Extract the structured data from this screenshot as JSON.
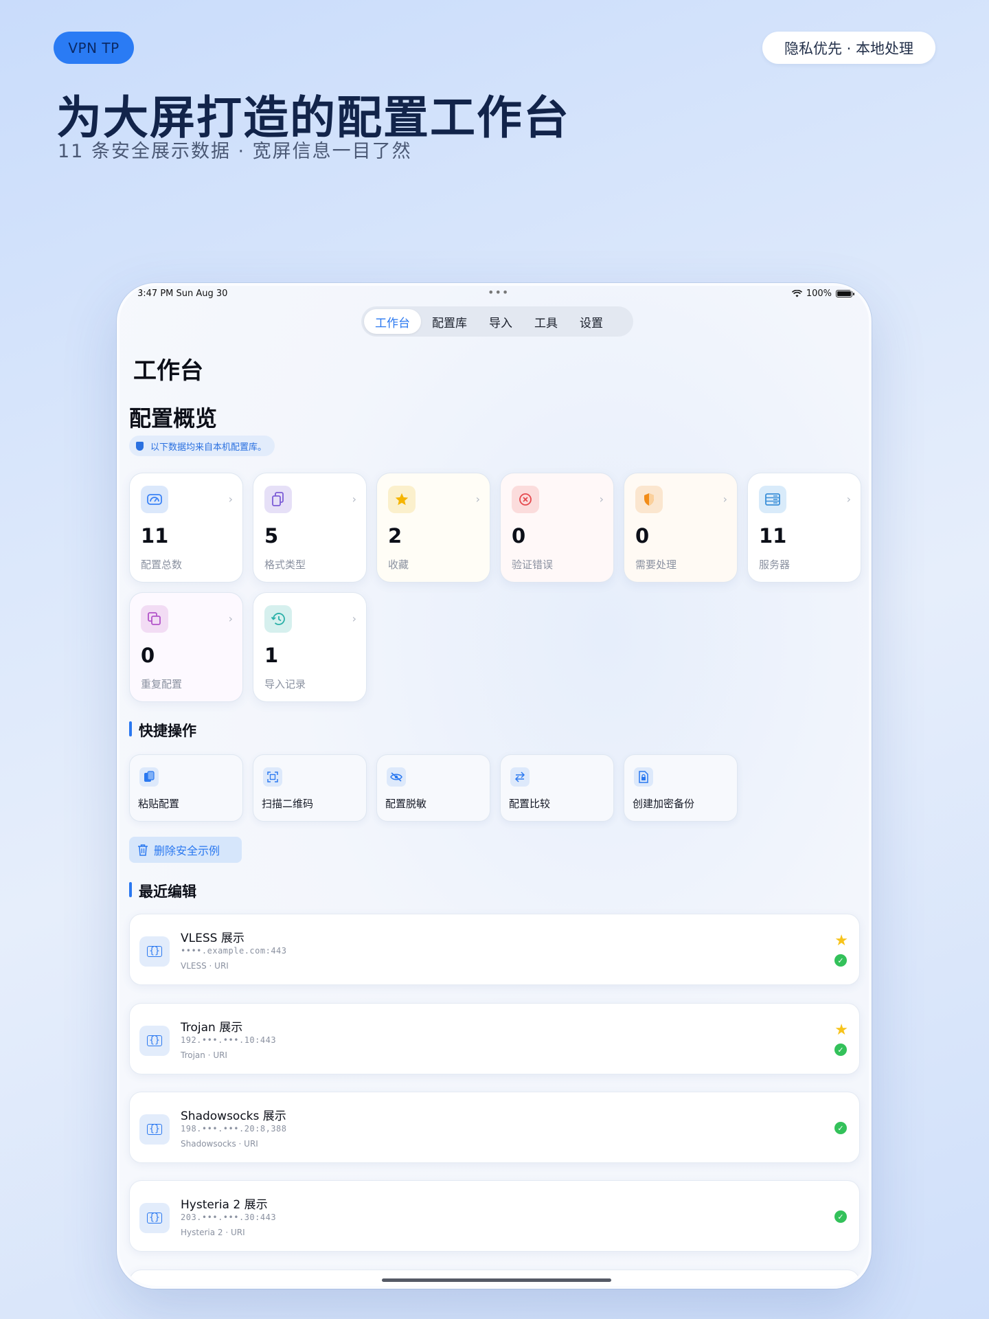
{
  "promo": {
    "brand": "VPN TP",
    "privacy": "隐私优先 · 本地处理",
    "title": "为大屏打造的配置工作台",
    "subtitle": "11 条安全展示数据 · 宽屏信息一目了然"
  },
  "status_bar": {
    "time": "3:47 PM  Sun Aug 30",
    "battery": "100%"
  },
  "tabs": [
    {
      "label": "工作台",
      "active": true
    },
    {
      "label": "配置库",
      "active": false
    },
    {
      "label": "导入",
      "active": false
    },
    {
      "label": "工具",
      "active": false
    },
    {
      "label": "设置",
      "active": false
    }
  ],
  "page_title": "工作台",
  "overview": {
    "title": "配置概览",
    "note": "以下数据均来自本机配置库。",
    "stats": [
      {
        "value": "11",
        "label": "配置总数",
        "icon": "gauge-icon",
        "accent": "#3b82f6",
        "bg": "#dbe8fb"
      },
      {
        "value": "5",
        "label": "格式类型",
        "icon": "documents-icon",
        "accent": "#7c5cd6",
        "bg": "#e6e0f7"
      },
      {
        "value": "2",
        "label": "收藏",
        "icon": "star-icon",
        "accent": "#f5b400",
        "bg": "#fbf0cc"
      },
      {
        "value": "0",
        "label": "验证错误",
        "icon": "error-icon",
        "accent": "#e5484d",
        "bg": "#fbdcdc"
      },
      {
        "value": "0",
        "label": "需要处理",
        "icon": "shield-icon",
        "accent": "#f28c18",
        "bg": "#fbe6cf"
      },
      {
        "value": "11",
        "label": "服务器",
        "icon": "server-icon",
        "accent": "#3a8fd8",
        "bg": "#d9ebfa"
      },
      {
        "value": "0",
        "label": "重复配置",
        "icon": "duplicate-icon",
        "accent": "#b253c9",
        "bg": "#f2dcf4"
      },
      {
        "value": "1",
        "label": "导入记录",
        "icon": "history-icon",
        "accent": "#2bb0a8",
        "bg": "#d6f0ee"
      }
    ]
  },
  "quick_actions": {
    "title": "快捷操作",
    "items": [
      {
        "label": "粘贴配置",
        "icon": "paste-icon"
      },
      {
        "label": "扫描二维码",
        "icon": "qrcode-scan-icon"
      },
      {
        "label": "配置脱敏",
        "icon": "eye-slash-icon"
      },
      {
        "label": "配置比较",
        "icon": "compare-arrows-icon"
      },
      {
        "label": "创建加密备份",
        "icon": "lock-document-icon"
      }
    ],
    "delete_label": "删除安全示例"
  },
  "recent": {
    "title": "最近编辑",
    "items": [
      {
        "name": "VLESS 展示",
        "host": "••••.example.com:443",
        "meta": "VLESS · URI",
        "starred": true
      },
      {
        "name": "Trojan 展示",
        "host": "192.•••.•••.10:443",
        "meta": "Trojan · URI",
        "starred": true
      },
      {
        "name": "Shadowsocks 展示",
        "host": "198.•••.•••.20:8,388",
        "meta": "Shadowsocks · URI",
        "starred": false
      },
      {
        "name": "Hysteria 2 展示",
        "host": "203.•••.•••.30:443",
        "meta": "Hysteria 2 · URI",
        "starred": false
      }
    ]
  }
}
